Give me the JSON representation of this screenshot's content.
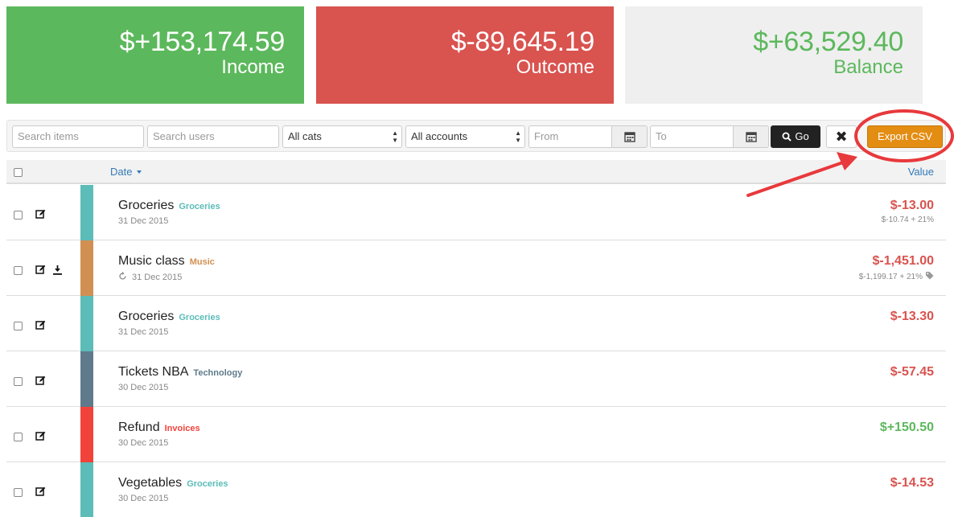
{
  "summary": {
    "income": {
      "amount": "$+153,174.59",
      "label": "Income"
    },
    "outcome": {
      "amount": "$-89,645.19",
      "label": "Outcome"
    },
    "balance": {
      "amount": "$+63,529.40",
      "label": "Balance"
    }
  },
  "filters": {
    "search_items_placeholder": "Search items",
    "search_users_placeholder": "Search users",
    "category_selected": "All cats",
    "account_selected": "All accounts",
    "from_placeholder": "From",
    "to_placeholder": "To",
    "go_label": "Go",
    "clear_label": "✖",
    "export_label": "Export CSV"
  },
  "table": {
    "date_header": "Date",
    "value_header": "Value",
    "rows": [
      {
        "name": "Groceries",
        "category": "Groceries",
        "category_color": "#5bbcb8",
        "date": "31 Dec 2015",
        "value": "$-13.00",
        "sub": "$-10.74 + 21%",
        "kind": "neg"
      },
      {
        "name": "Music class",
        "category": "Music",
        "category_color": "#d28f52",
        "date": "31 Dec 2015",
        "value": "$-1,451.00",
        "sub": "$-1,199.17 + 21%",
        "kind": "neg"
      },
      {
        "name": "Groceries",
        "category": "Groceries",
        "category_color": "#5bbcb8",
        "date": "31 Dec 2015",
        "value": "$-13.30",
        "sub": "",
        "kind": "neg"
      },
      {
        "name": "Tickets NBA",
        "category": "Technology",
        "category_color": "#5f7a8a",
        "date": "30 Dec 2015",
        "value": "$-57.45",
        "sub": "",
        "kind": "neg"
      },
      {
        "name": "Refund",
        "category": "Invoices",
        "category_color": "#f2433a",
        "date": "30 Dec 2015",
        "value": "$+150.50",
        "sub": "",
        "kind": "pos"
      },
      {
        "name": "Vegetables",
        "category": "Groceries",
        "category_color": "#5bbcb8",
        "date": "30 Dec 2015",
        "value": "$-14.53",
        "sub": "",
        "kind": "neg"
      }
    ]
  },
  "colors": {
    "income": "#5cb85c",
    "outcome": "#d9534f",
    "balance_bg": "#efefef",
    "export": "#e38d13",
    "annotation": "#e8393c"
  }
}
